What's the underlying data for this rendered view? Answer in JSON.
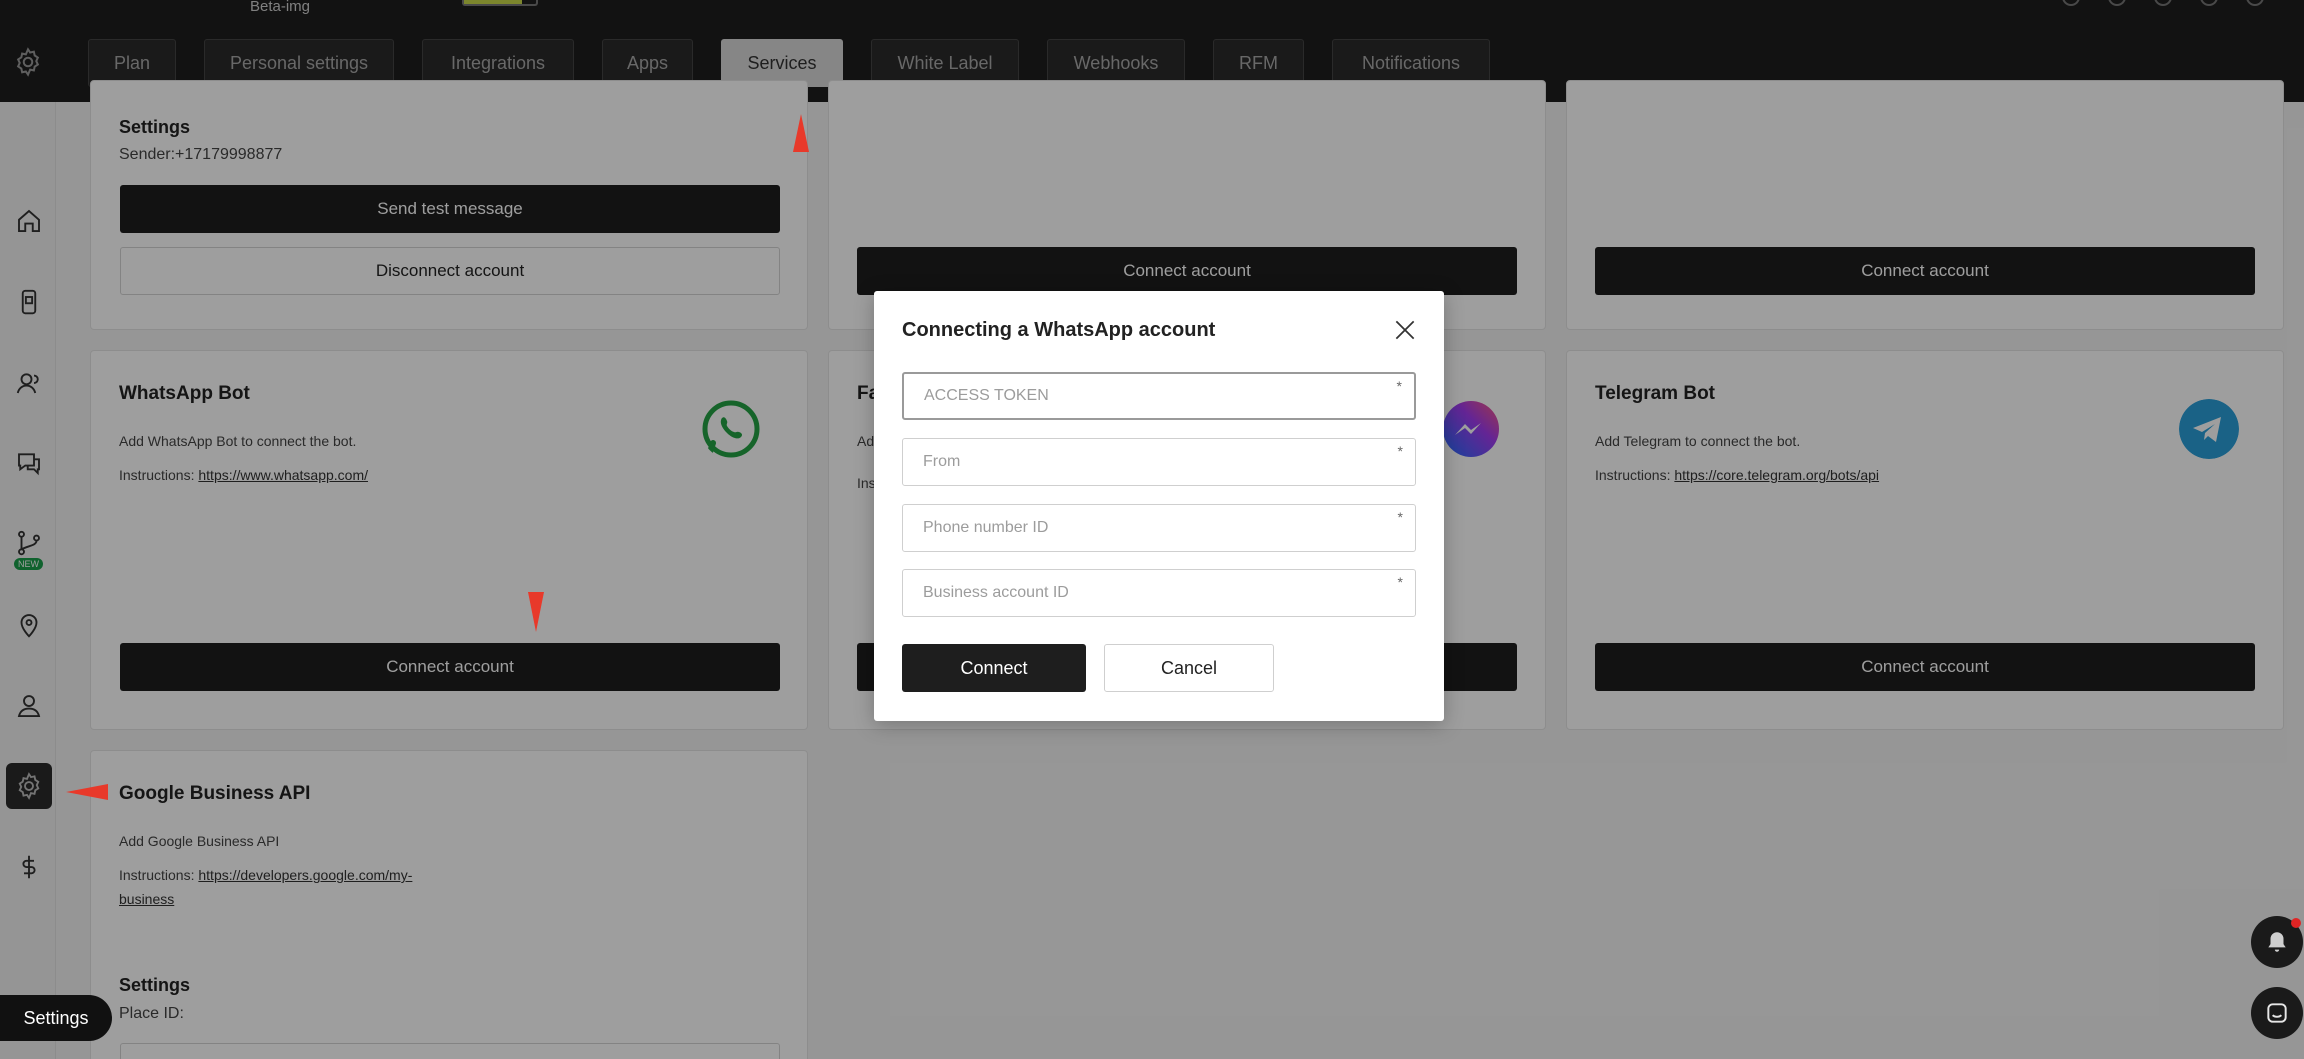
{
  "topbar": {
    "brand": "Beta-img"
  },
  "nav": {
    "tabs": [
      {
        "label": "Plan",
        "active": false
      },
      {
        "label": "Personal settings",
        "active": false
      },
      {
        "label": "Integrations",
        "active": false
      },
      {
        "label": "Apps",
        "active": false
      },
      {
        "label": "Services",
        "active": true
      },
      {
        "label": "White Label",
        "active": false
      },
      {
        "label": "Webhooks",
        "active": false
      },
      {
        "label": "RFM",
        "active": false
      },
      {
        "label": "Notifications",
        "active": false
      }
    ]
  },
  "sidebar": {
    "new_badge": "NEW"
  },
  "cards": {
    "sms": {
      "settings_label": "Settings",
      "sender": "Sender:+17179998877",
      "send_test": "Send test message",
      "disconnect": "Disconnect account"
    },
    "top_middle": {
      "connect": "Connect account"
    },
    "top_right": {
      "connect": "Connect account"
    },
    "whatsapp": {
      "title": "WhatsApp Bot",
      "desc": "Add WhatsApp Bot to connect the bot.",
      "instructions_label": "Instructions:",
      "link": "https://www.whatsapp.com/",
      "connect": "Connect account"
    },
    "facebook": {
      "title_partial": "Fa",
      "desc_partial": "Ad",
      "instr_partial": "Ins"
    },
    "telegram": {
      "title": "Telegram Bot",
      "desc": "Add Telegram to connect the bot.",
      "instructions_label": "Instructions:",
      "link": "https://core.telegram.org/bots/api",
      "connect": "Connect account"
    },
    "google": {
      "title": "Google Business API",
      "desc": "Add Google Business API",
      "instructions_label": "Instructions:",
      "link_line1": "https://developers.google.com/my-",
      "link_line2": "business",
      "settings_label": "Settings",
      "place_id": "Place ID:"
    }
  },
  "modal": {
    "title": "Connecting a WhatsApp account",
    "fields": [
      {
        "placeholder": "ACCESS TOKEN",
        "required": "*"
      },
      {
        "placeholder": "From",
        "required": "*"
      },
      {
        "placeholder": "Phone number ID",
        "required": "*"
      },
      {
        "placeholder": "Business account ID",
        "required": "*"
      }
    ],
    "connect": "Connect",
    "cancel": "Cancel"
  },
  "settings_pill": "Settings",
  "colors": {
    "whatsapp": "#25a244",
    "telegram": "#2a9fd8",
    "arrow": "#e8392a",
    "new_badge": "#1b9e4b"
  }
}
